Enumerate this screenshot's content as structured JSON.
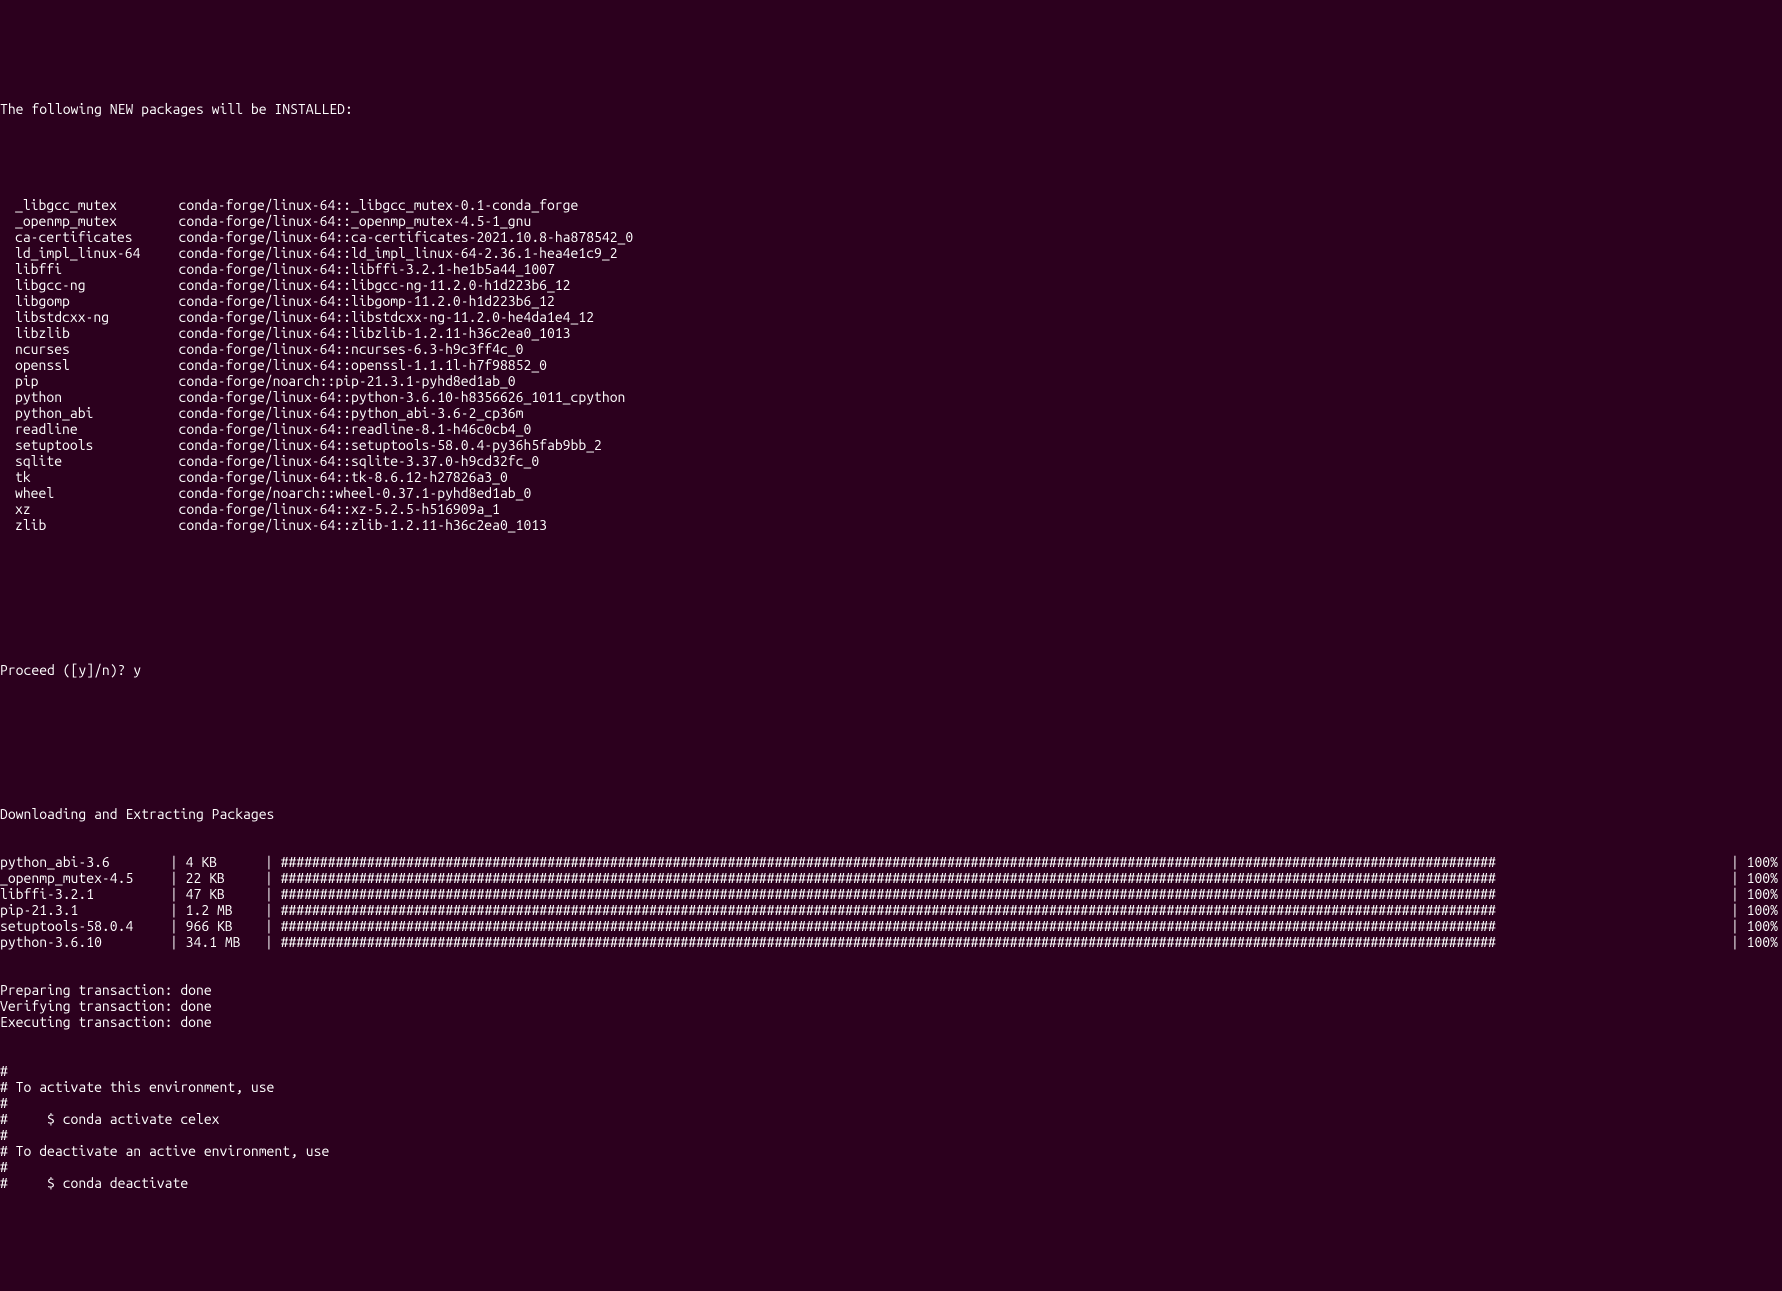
{
  "header": "The following NEW packages will be INSTALLED:",
  "packages": [
    {
      "name": "_libgcc_mutex",
      "spec": "conda-forge/linux-64::_libgcc_mutex-0.1-conda_forge"
    },
    {
      "name": "_openmp_mutex",
      "spec": "conda-forge/linux-64::_openmp_mutex-4.5-1_gnu"
    },
    {
      "name": "ca-certificates",
      "spec": "conda-forge/linux-64::ca-certificates-2021.10.8-ha878542_0"
    },
    {
      "name": "ld_impl_linux-64",
      "spec": "conda-forge/linux-64::ld_impl_linux-64-2.36.1-hea4e1c9_2"
    },
    {
      "name": "libffi",
      "spec": "conda-forge/linux-64::libffi-3.2.1-he1b5a44_1007"
    },
    {
      "name": "libgcc-ng",
      "spec": "conda-forge/linux-64::libgcc-ng-11.2.0-h1d223b6_12"
    },
    {
      "name": "libgomp",
      "spec": "conda-forge/linux-64::libgomp-11.2.0-h1d223b6_12"
    },
    {
      "name": "libstdcxx-ng",
      "spec": "conda-forge/linux-64::libstdcxx-ng-11.2.0-he4da1e4_12"
    },
    {
      "name": "libzlib",
      "spec": "conda-forge/linux-64::libzlib-1.2.11-h36c2ea0_1013"
    },
    {
      "name": "ncurses",
      "spec": "conda-forge/linux-64::ncurses-6.3-h9c3ff4c_0"
    },
    {
      "name": "openssl",
      "spec": "conda-forge/linux-64::openssl-1.1.1l-h7f98852_0"
    },
    {
      "name": "pip",
      "spec": "conda-forge/noarch::pip-21.3.1-pyhd8ed1ab_0"
    },
    {
      "name": "python",
      "spec": "conda-forge/linux-64::python-3.6.10-h8356626_1011_cpython"
    },
    {
      "name": "python_abi",
      "spec": "conda-forge/linux-64::python_abi-3.6-2_cp36m"
    },
    {
      "name": "readline",
      "spec": "conda-forge/linux-64::readline-8.1-h46c0cb4_0"
    },
    {
      "name": "setuptools",
      "spec": "conda-forge/linux-64::setuptools-58.0.4-py36h5fab9bb_2"
    },
    {
      "name": "sqlite",
      "spec": "conda-forge/linux-64::sqlite-3.37.0-h9cd32fc_0"
    },
    {
      "name": "tk",
      "spec": "conda-forge/linux-64::tk-8.6.12-h27826a3_0"
    },
    {
      "name": "wheel",
      "spec": "conda-forge/noarch::wheel-0.37.1-pyhd8ed1ab_0"
    },
    {
      "name": "xz",
      "spec": "conda-forge/linux-64::xz-5.2.5-h516909a_1"
    },
    {
      "name": "zlib",
      "spec": "conda-forge/linux-64::zlib-1.2.11-h36c2ea0_1013"
    }
  ],
  "prompt": "Proceed ([y]/n)? y",
  "downloading_header": "Downloading and Extracting Packages",
  "downloads": [
    {
      "name": "python_abi-3.6",
      "size": "4 KB",
      "percent": "100%"
    },
    {
      "name": "_openmp_mutex-4.5",
      "size": "22 KB",
      "percent": "100%"
    },
    {
      "name": "libffi-3.2.1",
      "size": "47 KB",
      "percent": "100%"
    },
    {
      "name": "pip-21.3.1",
      "size": "1.2 MB",
      "percent": "100%"
    },
    {
      "name": "setuptools-58.0.4",
      "size": "966 KB",
      "percent": "100%"
    },
    {
      "name": "python-3.6.10",
      "size": "34.1 MB",
      "percent": "100%"
    }
  ],
  "transactions": [
    "Preparing transaction: done",
    "Verifying transaction: done",
    "Executing transaction: done"
  ],
  "footer_lines": [
    "#",
    "# To activate this environment, use",
    "#",
    "#     $ conda activate celex",
    "#",
    "# To deactivate an active environment, use",
    "#",
    "#     $ conda deactivate"
  ],
  "progress_char": "#",
  "pipe": "|"
}
